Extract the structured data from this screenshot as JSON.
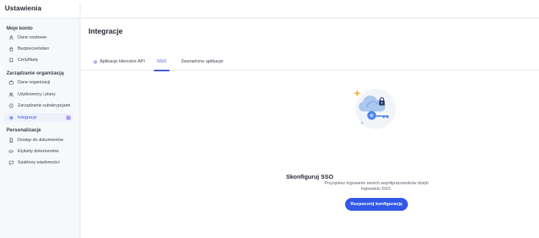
{
  "app": {
    "title": "Ustawienia"
  },
  "sidebar": {
    "sections": [
      {
        "title": "Moje konto",
        "items": [
          {
            "label": "Dane osobowe",
            "icon": "user-icon"
          },
          {
            "label": "Bezpieczeństwo",
            "icon": "lock-icon"
          },
          {
            "label": "Certyfikaty",
            "icon": "certificate-icon"
          }
        ]
      },
      {
        "title": "Zarządzanie organizacją",
        "items": [
          {
            "label": "Dane organizacji",
            "icon": "briefcase-icon"
          },
          {
            "label": "Użytkownicy i plany",
            "icon": "users-icon"
          },
          {
            "label": "Zarządzanie subskrypcjami",
            "icon": "subscription-icon"
          },
          {
            "label": "Integracje",
            "icon": "integrations-icon",
            "active": true
          }
        ]
      },
      {
        "title": "Personalizacje",
        "items": [
          {
            "label": "Dostęp do dokumentów",
            "icon": "document-icon"
          },
          {
            "label": "Etykiety dokumentów",
            "icon": "tag-icon"
          },
          {
            "label": "Szablony wiadomości",
            "icon": "message-icon"
          }
        ]
      }
    ]
  },
  "main": {
    "title": "Integracje",
    "tabs": [
      {
        "label": "Aplikacje klienckíe API"
      },
      {
        "label": "SSO",
        "active": true
      },
      {
        "label": "Zewnętrzne aplikacje"
      }
    ],
    "sso": {
      "title": "Skonfiguruj SSO",
      "description": "Przyspiesz logowanie swoich współpracowników dzięki logowaniu SSO.",
      "cta_label": "Rozpocznij konfigurację"
    }
  },
  "colors": {
    "accent": "#3b55d9",
    "button": "#3157e6",
    "badge": "#b59af2"
  }
}
